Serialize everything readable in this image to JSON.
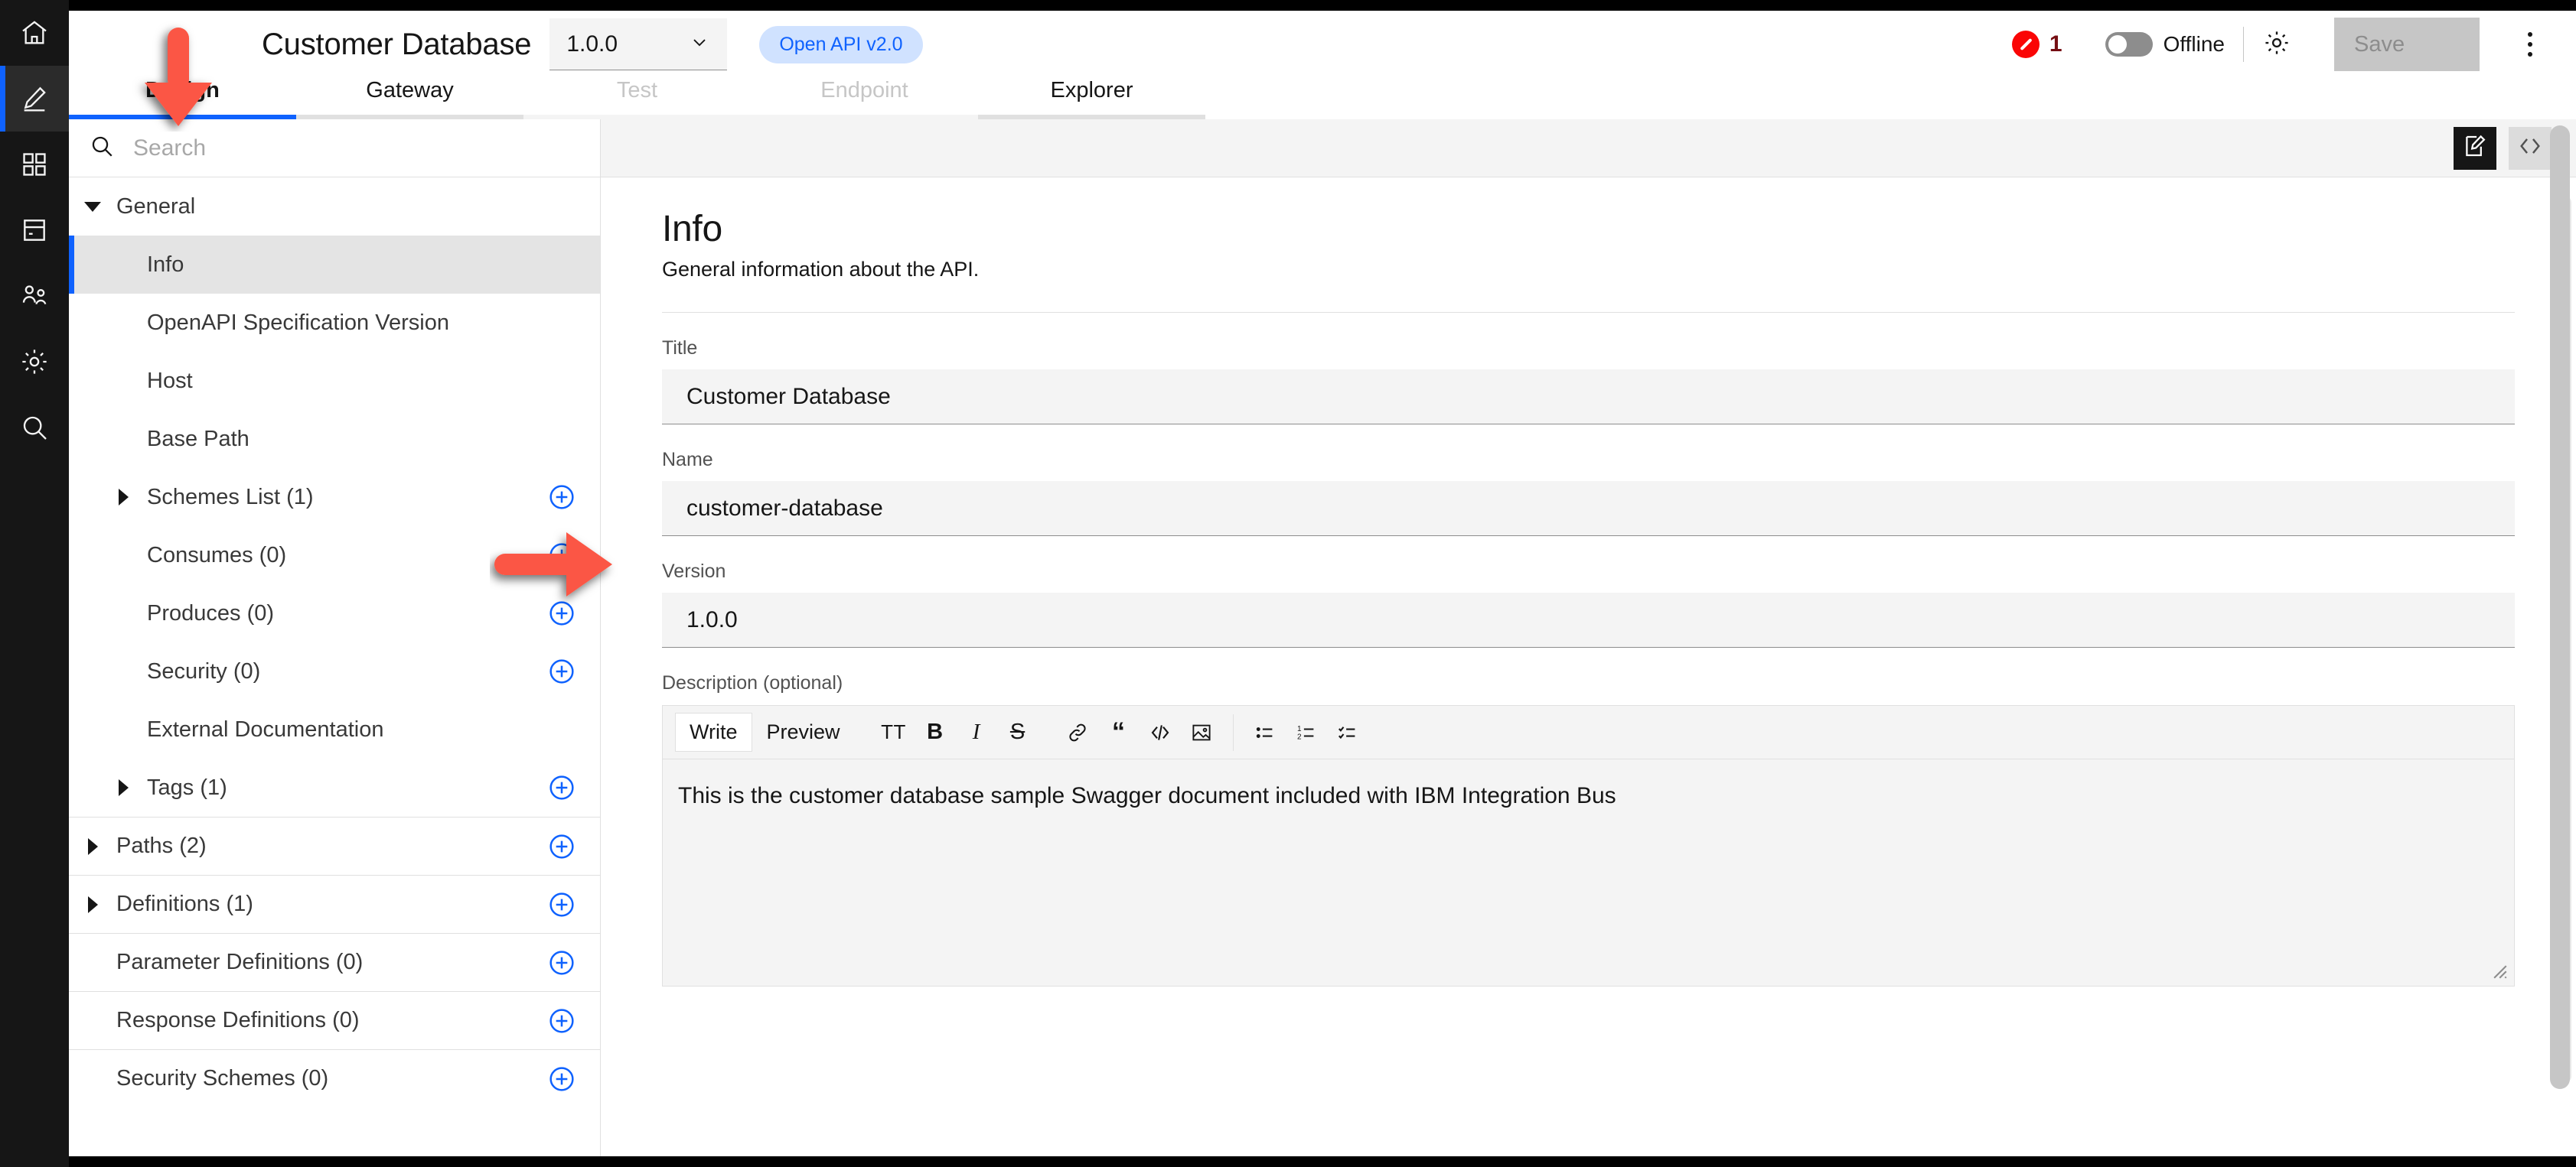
{
  "rail": {
    "items": [
      {
        "icon": "home-icon",
        "name": "home",
        "active": false
      },
      {
        "icon": "pencil-icon",
        "name": "design",
        "active": true
      },
      {
        "icon": "grid-icon",
        "name": "apps",
        "active": false
      },
      {
        "icon": "server-icon",
        "name": "catalog",
        "active": false
      },
      {
        "icon": "users-icon",
        "name": "members",
        "active": false
      },
      {
        "icon": "gear-icon",
        "name": "settings",
        "active": false
      },
      {
        "icon": "search-icon",
        "name": "search",
        "active": false
      }
    ]
  },
  "header": {
    "title": "Customer Database",
    "version": "1.0.0",
    "version_caret_icon": "chevron-down-icon",
    "spec_badge": "Open API v2.0",
    "error_icon": "error-circle-icon",
    "error_count": "1",
    "online_toggle_state": "off",
    "online_toggle_label": "Offline",
    "gear_icon": "gear-icon",
    "save_label": "Save",
    "overflow_icon": "overflow-menu-icon"
  },
  "tabs": [
    {
      "label": "Design",
      "state": "active"
    },
    {
      "label": "Gateway",
      "state": "normal"
    },
    {
      "label": "Test",
      "state": "disabled"
    },
    {
      "label": "Endpoint",
      "state": "disabled"
    },
    {
      "label": "Explorer",
      "state": "normal"
    }
  ],
  "sidebar": {
    "search_icon": "search-icon",
    "search_value": "",
    "search_placeholder": "Search",
    "tree": [
      {
        "label": "General",
        "caret": "down",
        "indent": 0,
        "add": false,
        "selected": false,
        "sep": false
      },
      {
        "label": "Info",
        "caret": "none",
        "indent": 1,
        "add": false,
        "selected": true,
        "sep": false
      },
      {
        "label": "OpenAPI Specification Version",
        "caret": "none",
        "indent": 1,
        "add": false,
        "selected": false,
        "sep": false
      },
      {
        "label": "Host",
        "caret": "none",
        "indent": 1,
        "add": false,
        "selected": false,
        "sep": false
      },
      {
        "label": "Base Path",
        "caret": "none",
        "indent": 1,
        "add": false,
        "selected": false,
        "sep": false
      },
      {
        "label": "Schemes List (1)",
        "caret": "right",
        "indent": 1,
        "add": true,
        "selected": false,
        "sep": false
      },
      {
        "label": "Consumes (0)",
        "caret": "none",
        "indent": 1,
        "add": true,
        "selected": false,
        "sep": false
      },
      {
        "label": "Produces (0)",
        "caret": "none",
        "indent": 1,
        "add": true,
        "selected": false,
        "sep": false
      },
      {
        "label": "Security (0)",
        "caret": "none",
        "indent": 1,
        "add": true,
        "selected": false,
        "sep": false
      },
      {
        "label": "External Documentation",
        "caret": "none",
        "indent": 1,
        "add": false,
        "selected": false,
        "sep": false
      },
      {
        "label": "Tags (1)",
        "caret": "right",
        "indent": 1,
        "add": true,
        "selected": false,
        "sep": false
      },
      {
        "label": "Paths (2)",
        "caret": "right",
        "indent": 0,
        "add": true,
        "selected": false,
        "sep": true
      },
      {
        "label": "Definitions (1)",
        "caret": "right",
        "indent": 0,
        "add": true,
        "selected": false,
        "sep": true
      },
      {
        "label": "Parameter Definitions (0)",
        "caret": "none",
        "indent": 0,
        "add": true,
        "selected": false,
        "sep": true
      },
      {
        "label": "Response Definitions (0)",
        "caret": "none",
        "indent": 0,
        "add": true,
        "selected": false,
        "sep": true
      },
      {
        "label": "Security Schemes (0)",
        "caret": "none",
        "indent": 0,
        "add": true,
        "selected": false,
        "sep": true
      }
    ]
  },
  "main": {
    "view_toggle": {
      "edit_icon": "edit-document-icon",
      "code_icon": "code-brackets-icon",
      "active": "edit"
    },
    "heading": "Info",
    "subheading": "General information about the API.",
    "fields": {
      "title_label": "Title",
      "title_value": "Customer Database",
      "name_label": "Name",
      "name_value": "customer-database",
      "version_label": "Version",
      "version_value": "1.0.0",
      "description_label": "Description (optional)"
    },
    "markdown": {
      "write_tab": "Write",
      "preview_tab": "Preview",
      "active_tab": "Write",
      "buttons": [
        {
          "icon": "heading-tt-icon",
          "glyph": "TT"
        },
        {
          "icon": "bold-icon",
          "glyph": "B"
        },
        {
          "icon": "italic-icon",
          "glyph": "I"
        },
        {
          "icon": "strikethrough-icon",
          "glyph": "S"
        },
        {
          "icon": "link-icon",
          "glyph": ""
        },
        {
          "icon": "quote-icon",
          "glyph": "“"
        },
        {
          "icon": "code-icon",
          "glyph": "</>"
        },
        {
          "icon": "image-icon",
          "glyph": ""
        },
        {
          "icon": "bulleted-list-icon",
          "glyph": ""
        },
        {
          "icon": "numbered-list-icon",
          "glyph": ""
        },
        {
          "icon": "task-list-icon",
          "glyph": ""
        }
      ],
      "content": "This is the customer database sample Swagger document included with IBM Integration Bus",
      "resize_handle_icon": "resize-handle-icon"
    }
  },
  "annotations": {
    "arrow_color": "#fb5744",
    "down_arrow_target": "Design tab",
    "right_arrow_target": "Schemes List add button"
  },
  "colors": {
    "accent": "#0f62fe",
    "badge_bg": "#d0e2ff",
    "error": "#fa0606",
    "rail_bg": "#161616",
    "field_bg": "#f4f4f4"
  }
}
